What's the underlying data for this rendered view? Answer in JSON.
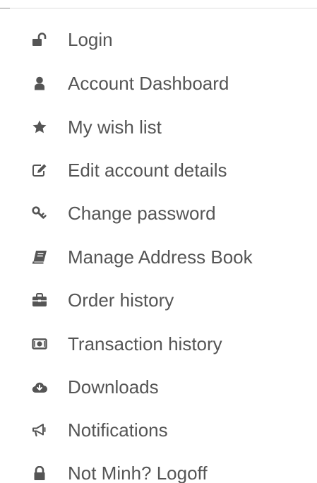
{
  "account_menu": {
    "items": [
      {
        "label": "Login",
        "icon": "unlock-icon"
      },
      {
        "label": "Account Dashboard",
        "icon": "user-icon"
      },
      {
        "label": "My wish list",
        "icon": "star-icon"
      },
      {
        "label": "Edit account details",
        "icon": "edit-icon"
      },
      {
        "label": "Change password",
        "icon": "key-icon"
      },
      {
        "label": "Manage Address Book",
        "icon": "book-icon"
      },
      {
        "label": "Order history",
        "icon": "briefcase-icon"
      },
      {
        "label": "Transaction history",
        "icon": "money-icon"
      },
      {
        "label": "Downloads",
        "icon": "cloud-download-icon"
      },
      {
        "label": "Notifications",
        "icon": "bullhorn-icon"
      },
      {
        "label": "Not Minh? Logoff",
        "icon": "lock-icon"
      }
    ]
  },
  "colors": {
    "text": "#555555",
    "icon": "#555555"
  }
}
